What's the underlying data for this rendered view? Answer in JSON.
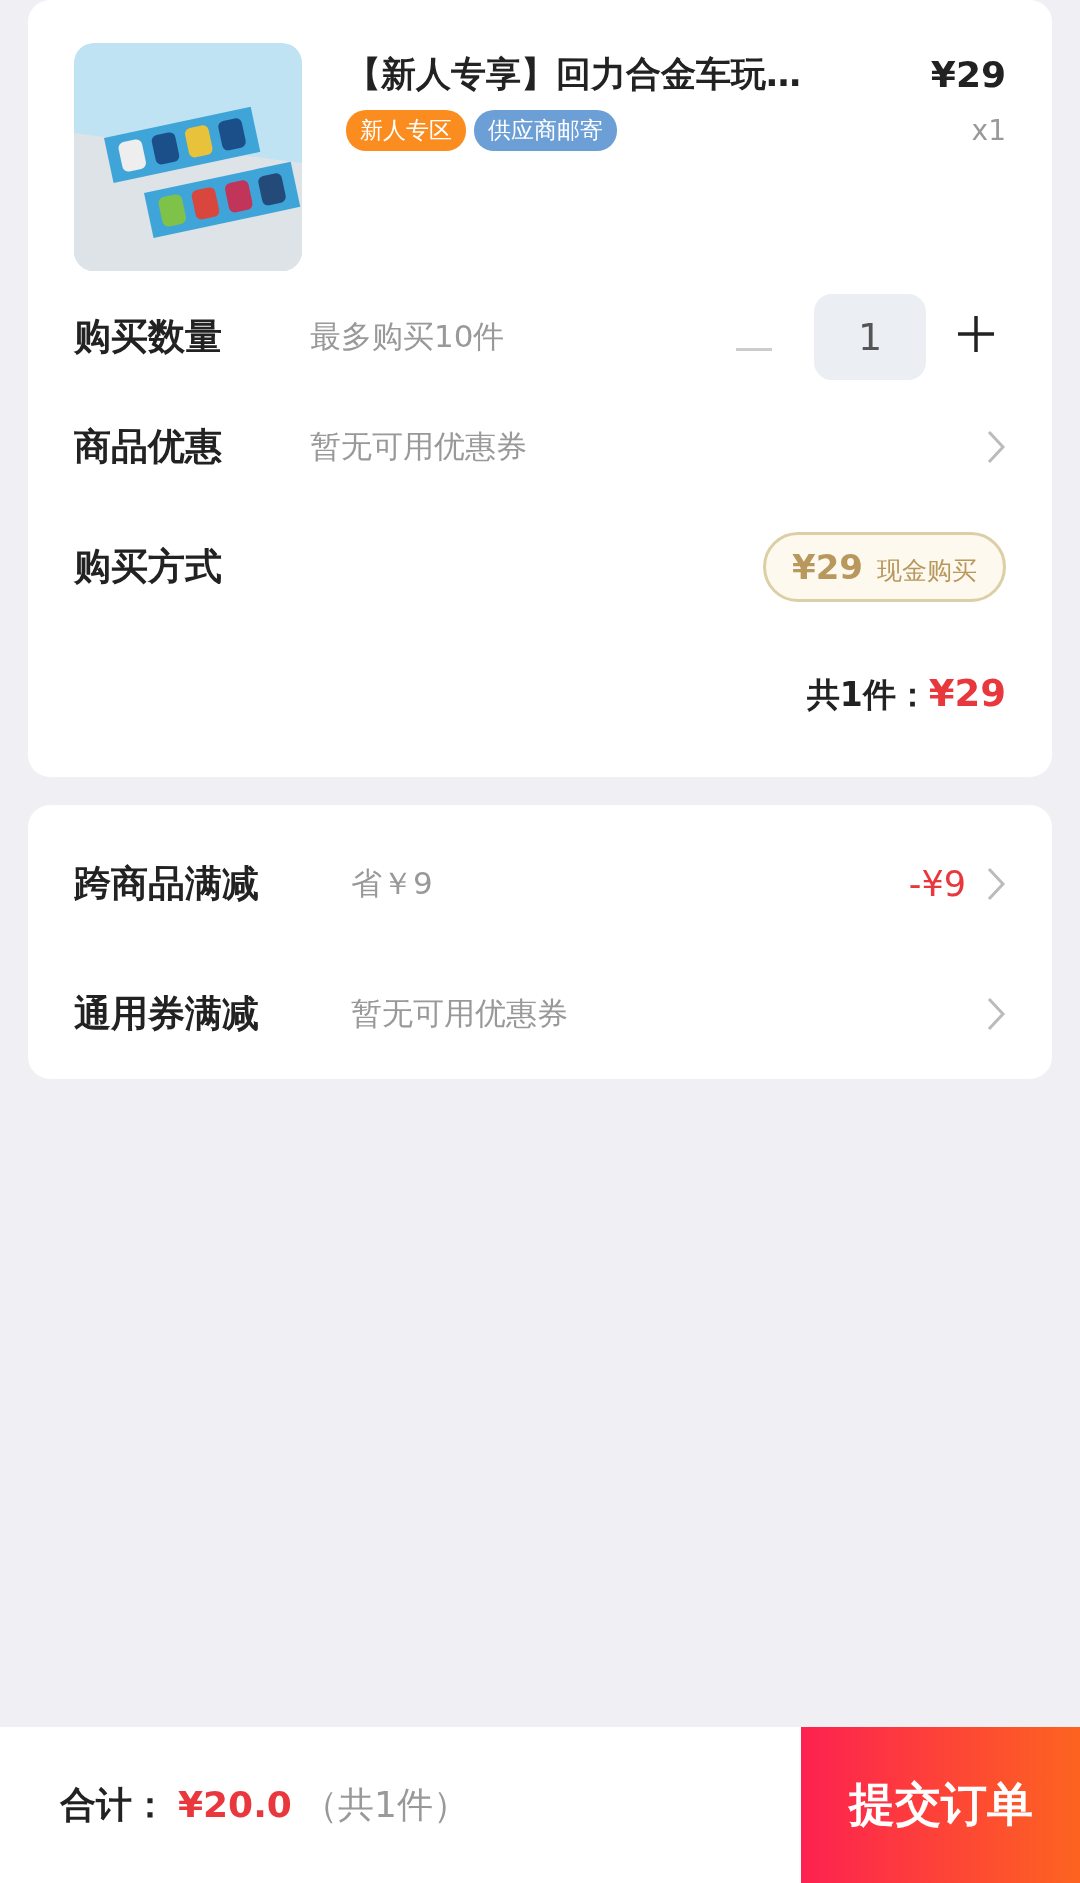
{
  "product": {
    "title": "【新人专享】回力合金车玩…",
    "price": "¥29",
    "quantity": "x1",
    "tags": [
      {
        "label": "新人专区",
        "color": "#fb8c1f"
      },
      {
        "label": "供应商邮寄",
        "color": "#6b9fd6"
      }
    ]
  },
  "rows": [
    {
      "kind": "stepper",
      "label": "购买数量",
      "hint": "最多购买10件",
      "value": "1",
      "decrease_disabled": true
    },
    {
      "kind": "link",
      "label": "商品优惠",
      "hint": "暂无可用优惠券"
    },
    {
      "kind": "option",
      "label": "购买方式",
      "options": [
        {
          "price": "¥29",
          "label": "现金购买",
          "selected": true
        }
      ]
    }
  ],
  "subtotal": {
    "label": "共1件：",
    "amount": "¥29"
  },
  "discounts": [
    {
      "label": "跨商品满减",
      "hint": "省￥9",
      "amount": "-¥9"
    },
    {
      "label": "通用券满减",
      "hint": "暂无可用优惠券"
    }
  ],
  "footer": {
    "label": "合计：",
    "amount": "¥20.0",
    "count": "（共1件）",
    "submit": "提交订单"
  }
}
